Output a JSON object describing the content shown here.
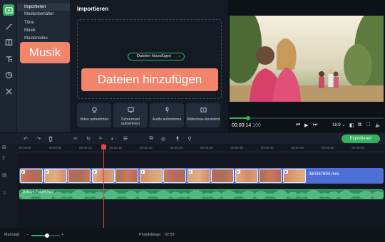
{
  "sidebar": {
    "categories": [
      {
        "label": "Importieren",
        "selected": true
      },
      {
        "label": "Medienbehälter",
        "selected": false
      },
      {
        "label": "Töne",
        "selected": false
      },
      {
        "label": "Musik",
        "selected": false
      },
      {
        "label": "Mustervideo",
        "selected": false
      }
    ],
    "rail_icons": [
      "import-icon",
      "magic-wand-icon",
      "transitions-icon",
      "text-icon",
      "stickers-icon",
      "tools-icon"
    ]
  },
  "import_panel": {
    "title": "Importieren",
    "add_files_button": "Dateien hinzufügen",
    "tiles": [
      {
        "label": "Video aufnehmen",
        "icon": "camera-icon"
      },
      {
        "label": "Screencast aufnehmen",
        "icon": "monitor-icon"
      },
      {
        "label": "Audio aufnehmen",
        "icon": "microphone-icon"
      },
      {
        "label": "Slideshow-Assistent",
        "icon": "slideshow-icon"
      }
    ]
  },
  "player": {
    "time_main": "00:00:14",
    "time_ms": "100",
    "aspect": "16:9",
    "progress_fraction": 0.12
  },
  "toolbar": {
    "export_label": "Exportieren"
  },
  "timeline": {
    "ruler_ticks": [
      "00:00:00",
      "00:00:05",
      "00:00:10",
      "00:00:15",
      "00:00:20",
      "00:00:25",
      "00:00:30",
      "00:00:35",
      "00:00:40",
      "00:00:45",
      "00:00:50",
      "00:00:55"
    ],
    "video_clip_name": "480367694.mov",
    "audio_clip_name": "Brilliant Future.mp3"
  },
  "statusbar": {
    "zoom_label": "Maßstab:",
    "project_length_label": "Projektlänge:",
    "project_length_value": "02:53",
    "zoom_fraction": 0.55
  },
  "callouts": {
    "musik": "Musik",
    "add_files": "Dateien hinzufügen"
  },
  "colors": {
    "accent": "#32b160",
    "callout": "#f2846c",
    "video_track": "#4e6fd6",
    "audio_track": "#2a8e5a",
    "playhead": "#e0454b"
  }
}
